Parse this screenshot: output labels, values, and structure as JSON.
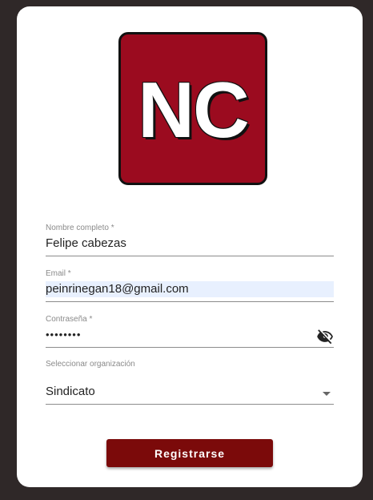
{
  "logo": {
    "text": "NC",
    "color": "#9b0b1f"
  },
  "form": {
    "name": {
      "label": "Nombre completo *",
      "value": "Felipe cabezas"
    },
    "email": {
      "label": "Email *",
      "value": "peinrinegan18@gmail.com"
    },
    "password": {
      "label": "Contraseña *",
      "value": "••••••••",
      "toggle_icon": "eye-off-icon"
    },
    "organization": {
      "label": "Seleccionar organización",
      "value": "Sindicato",
      "dropdown_icon": "caret-down-icon"
    }
  },
  "submit": {
    "label": "Registrarse",
    "color": "#7b0a0a"
  }
}
